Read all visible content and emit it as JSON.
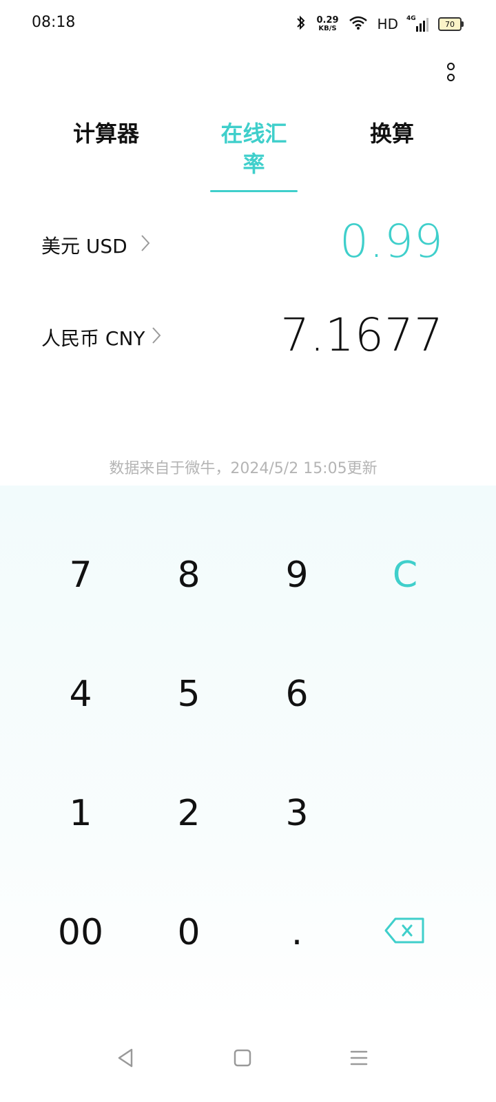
{
  "status_bar": {
    "time": "08:18",
    "net_speed_value": "0.29",
    "net_speed_unit": "KB/S",
    "hd_label": "HD",
    "network_type": "4G",
    "battery_level": "70"
  },
  "tabs": [
    {
      "label": "计算器",
      "active": false
    },
    {
      "label": "在线汇率",
      "active": true
    },
    {
      "label": "换算",
      "active": false
    }
  ],
  "currencies": {
    "from": {
      "label": "美元 USD",
      "amount": "0.99"
    },
    "to": {
      "label": "人民币 CNY",
      "amount": "7.1677"
    }
  },
  "update_note": "数据来自于微牛，2024/5/2 15:05更新",
  "keypad": {
    "k7": "7",
    "k8": "8",
    "k9": "9",
    "clear": "C",
    "k4": "4",
    "k5": "5",
    "k6": "6",
    "k1": "1",
    "k2": "2",
    "k3": "3",
    "k00": "00",
    "k0": "0",
    "dot": ".",
    "backspace_icon": "backspace-icon"
  },
  "colors": {
    "accent": "#3fcfcb",
    "text": "#111111",
    "muted": "#b4b4b4",
    "keypad_bg": "#f2fbfc"
  }
}
